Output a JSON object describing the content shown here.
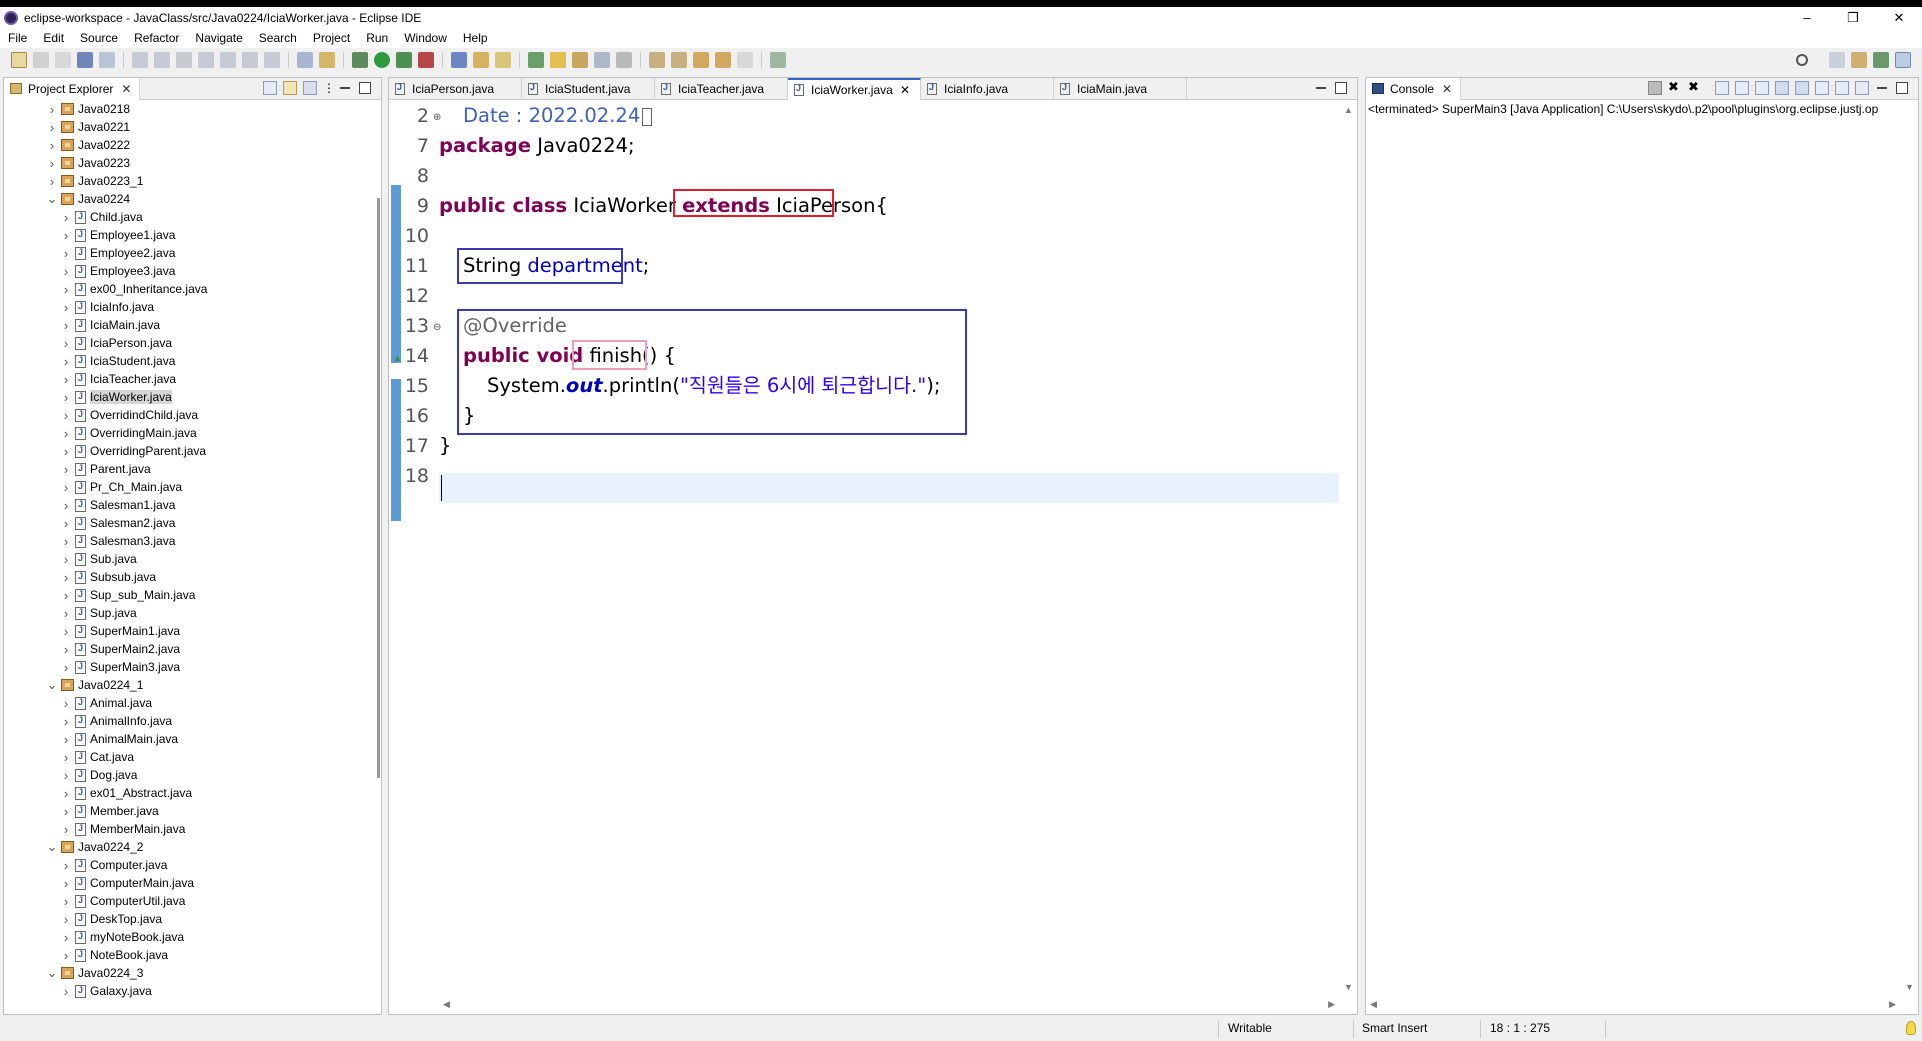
{
  "window": {
    "title": "eclipse-workspace - JavaClass/src/Java0224/IciaWorker.java - Eclipse IDE",
    "minimize": "–",
    "restore": "❐",
    "close": "✕"
  },
  "menu": [
    "File",
    "Edit",
    "Source",
    "Refactor",
    "Navigate",
    "Search",
    "Project",
    "Run",
    "Window",
    "Help"
  ],
  "project_explorer": {
    "title": "Project Explorer",
    "items": [
      {
        "label": "Java0218",
        "type": "package",
        "expanded": false,
        "level": 1
      },
      {
        "label": "Java0221",
        "type": "package",
        "expanded": false,
        "level": 1
      },
      {
        "label": "Java0222",
        "type": "package",
        "expanded": false,
        "level": 1
      },
      {
        "label": "Java0223",
        "type": "package",
        "expanded": false,
        "level": 1
      },
      {
        "label": "Java0223_1",
        "type": "package",
        "expanded": false,
        "level": 1
      },
      {
        "label": "Java0224",
        "type": "package",
        "expanded": true,
        "level": 1
      },
      {
        "label": "Child.java",
        "type": "file",
        "level": 2
      },
      {
        "label": "Employee1.java",
        "type": "file",
        "level": 2
      },
      {
        "label": "Employee2.java",
        "type": "file",
        "level": 2
      },
      {
        "label": "Employee3.java",
        "type": "file",
        "level": 2
      },
      {
        "label": "ex00_Inheritance.java",
        "type": "file",
        "level": 2
      },
      {
        "label": "IciaInfo.java",
        "type": "file",
        "level": 2
      },
      {
        "label": "IciaMain.java",
        "type": "file",
        "level": 2
      },
      {
        "label": "IciaPerson.java",
        "type": "file",
        "level": 2
      },
      {
        "label": "IciaStudent.java",
        "type": "file",
        "level": 2
      },
      {
        "label": "IciaTeacher.java",
        "type": "file",
        "level": 2
      },
      {
        "label": "IciaWorker.java",
        "type": "file",
        "level": 2,
        "selected": true
      },
      {
        "label": "OverridindChild.java",
        "type": "file",
        "level": 2
      },
      {
        "label": "OverridingMain.java",
        "type": "file",
        "level": 2
      },
      {
        "label": "OverridingParent.java",
        "type": "file",
        "level": 2
      },
      {
        "label": "Parent.java",
        "type": "file",
        "level": 2
      },
      {
        "label": "Pr_Ch_Main.java",
        "type": "file",
        "level": 2
      },
      {
        "label": "Salesman1.java",
        "type": "file",
        "level": 2
      },
      {
        "label": "Salesman2.java",
        "type": "file",
        "level": 2
      },
      {
        "label": "Salesman3.java",
        "type": "file",
        "level": 2
      },
      {
        "label": "Sub.java",
        "type": "file",
        "level": 2
      },
      {
        "label": "Subsub.java",
        "type": "file",
        "level": 2
      },
      {
        "label": "Sup_sub_Main.java",
        "type": "file",
        "level": 2
      },
      {
        "label": "Sup.java",
        "type": "file",
        "level": 2
      },
      {
        "label": "SuperMain1.java",
        "type": "file",
        "level": 2
      },
      {
        "label": "SuperMain2.java",
        "type": "file",
        "level": 2
      },
      {
        "label": "SuperMain3.java",
        "type": "file",
        "level": 2
      },
      {
        "label": "Java0224_1",
        "type": "package",
        "expanded": true,
        "level": 1
      },
      {
        "label": "Animal.java",
        "type": "file",
        "level": 2
      },
      {
        "label": "AnimalInfo.java",
        "type": "file",
        "level": 2
      },
      {
        "label": "AnimalMain.java",
        "type": "file",
        "level": 2
      },
      {
        "label": "Cat.java",
        "type": "file",
        "level": 2
      },
      {
        "label": "Dog.java",
        "type": "file",
        "level": 2
      },
      {
        "label": "ex01_Abstract.java",
        "type": "file",
        "level": 2
      },
      {
        "label": "Member.java",
        "type": "file",
        "level": 2
      },
      {
        "label": "MemberMain.java",
        "type": "file",
        "level": 2
      },
      {
        "label": "Java0224_2",
        "type": "package",
        "expanded": true,
        "level": 1
      },
      {
        "label": "Computer.java",
        "type": "file",
        "level": 2
      },
      {
        "label": "ComputerMain.java",
        "type": "file",
        "level": 2
      },
      {
        "label": "ComputerUtil.java",
        "type": "file",
        "level": 2
      },
      {
        "label": "DeskTop.java",
        "type": "file",
        "level": 2
      },
      {
        "label": "myNoteBook.java",
        "type": "file",
        "level": 2
      },
      {
        "label": "NoteBook.java",
        "type": "file",
        "level": 2
      },
      {
        "label": "Java0224_3",
        "type": "package",
        "expanded": true,
        "level": 1
      },
      {
        "label": "Galaxy.java",
        "type": "file",
        "level": 2
      }
    ]
  },
  "editor": {
    "tabs": [
      {
        "label": "IciaPerson.java",
        "active": false
      },
      {
        "label": "IciaStudent.java",
        "active": false
      },
      {
        "label": "IciaTeacher.java",
        "active": false
      },
      {
        "label": "IciaWorker.java",
        "active": true
      },
      {
        "label": "IciaInfo.java",
        "active": false
      },
      {
        "label": "IciaMain.java",
        "active": false
      }
    ],
    "tab_close": "✕",
    "line_numbers": [
      "2",
      "7",
      "8",
      "9",
      "10",
      "11",
      "12",
      "13",
      "14",
      "15",
      "16",
      "17",
      "18"
    ],
    "code": {
      "l2": "Date : 2022.02.24",
      "l7_kw": "package",
      "l7_rest": " Java0224;",
      "l9_kw1": "public class",
      "l9_name": " IciaWorker ",
      "l9_kw2": "extends",
      "l9_parent": " IciaPerson",
      "l9_brace": "{",
      "l11_type": "String ",
      "l11_field": "department",
      "l11_semi": ";",
      "l13_ann": "@Override",
      "l14_kw": "public void",
      "l14_method": "finish()",
      "l14_brace": " {",
      "l15_pre": "System.",
      "l15_out": "out",
      "l15_mid": ".println(",
      "l15_str": "\"직원들은 6시에 퇴근합니다.\"",
      "l15_end": ");",
      "l16": "}",
      "l17": "}"
    }
  },
  "console": {
    "title": "Console",
    "text": "<terminated> SuperMain3 [Java Application] C:\\Users\\skydo\\.p2\\pool\\plugins\\org.eclipse.justj.op"
  },
  "status": {
    "writable": "Writable",
    "insert_mode": "Smart Insert",
    "position": "18 : 1 : 275"
  },
  "colors": {
    "keyword": "#7f0055",
    "annotation_red_box": "#e01e2e",
    "annotation_blue_box": "#3a3ab4",
    "annotation_pink_box": "#f0a0b4",
    "string": "#2a00ff",
    "field": "#0000c0"
  }
}
